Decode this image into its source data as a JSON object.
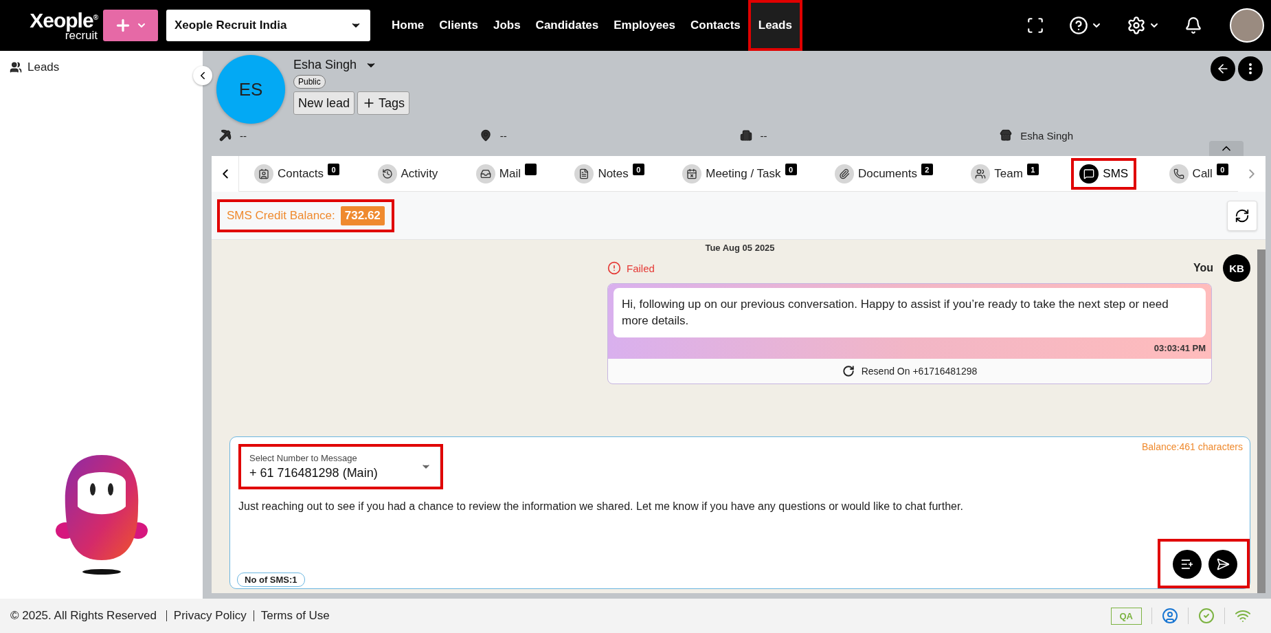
{
  "topbar": {
    "logo": {
      "word": "Xeople",
      "mark": "®",
      "sub": "recruit"
    },
    "company": "Xeople Recruit India",
    "nav": [
      {
        "label": "Home",
        "selected": false,
        "highlighted": false
      },
      {
        "label": "Clients",
        "selected": false,
        "highlighted": false
      },
      {
        "label": "Jobs",
        "selected": false,
        "highlighted": false
      },
      {
        "label": "Candidates",
        "selected": false,
        "highlighted": false
      },
      {
        "label": "Employees",
        "selected": false,
        "highlighted": false
      },
      {
        "label": "Contacts",
        "selected": false,
        "highlighted": false
      },
      {
        "label": "Leads",
        "selected": true,
        "highlighted": true
      }
    ]
  },
  "sidebar": {
    "items": [
      {
        "label": "Leads"
      }
    ]
  },
  "record": {
    "initials": "ES",
    "name": "Esha Singh",
    "visibility": "Public",
    "status": "New lead",
    "tags_button": "Tags",
    "fields": [
      {
        "kind": "industry",
        "value": "--"
      },
      {
        "kind": "location",
        "value": "--"
      },
      {
        "kind": "company",
        "value": "--"
      },
      {
        "kind": "owner",
        "value": "Esha Singh"
      }
    ]
  },
  "tabs": [
    {
      "kind": "contacts",
      "label": "Contacts",
      "badge": true,
      "count": "0",
      "selected": false,
      "highlighted": false
    },
    {
      "kind": "activity",
      "label": "Activity",
      "badge": false,
      "selected": false,
      "highlighted": false
    },
    {
      "kind": "mail",
      "label": "Mail",
      "badge": true,
      "selected": false,
      "highlighted": false
    },
    {
      "kind": "notes",
      "label": "Notes",
      "badge": true,
      "count": "0",
      "selected": false,
      "highlighted": false
    },
    {
      "kind": "meeting",
      "label": "Meeting / Task",
      "badge": true,
      "count": "0",
      "selected": false,
      "highlighted": false
    },
    {
      "kind": "documents",
      "label": "Documents",
      "badge": true,
      "count": "2",
      "selected": false,
      "highlighted": false
    },
    {
      "kind": "team",
      "label": "Team",
      "badge": true,
      "count": "1",
      "selected": false,
      "highlighted": false
    },
    {
      "kind": "sms",
      "label": "SMS",
      "badge": false,
      "selected": true,
      "highlighted": true
    },
    {
      "kind": "call",
      "label": "Call",
      "badge": true,
      "count": "0",
      "selected": false,
      "highlighted": false
    }
  ],
  "credit": {
    "label": "SMS Credit Balance:",
    "value": "732.62",
    "highlighted": true
  },
  "chat": {
    "date": "Tue Aug 05 2025",
    "messages": [
      {
        "status": "Failed",
        "sender": "You",
        "initials": "KB",
        "text": "Hi, following up on our previous conversation. Happy to assist if you’re ready to take the next step or need more details.",
        "time": "03:03:41 PM",
        "resend": "Resend On +61716481298"
      }
    ]
  },
  "compose": {
    "balance": "Balance:461 characters",
    "select_label": "Select Number to Message",
    "select_value": "+ 61 716481298 (Main)",
    "select_highlighted": true,
    "message": "Just reaching out to see if you had a chance to review the information we shared. Let me know if you have any questions or would like to chat further.",
    "sms_count": "No of SMS:1",
    "actions_highlighted": true
  },
  "footer": {
    "copyright": "© 2025. All Rights Reserved",
    "links": [
      "Privacy Policy",
      "Terms of Use"
    ],
    "env": "QA"
  }
}
